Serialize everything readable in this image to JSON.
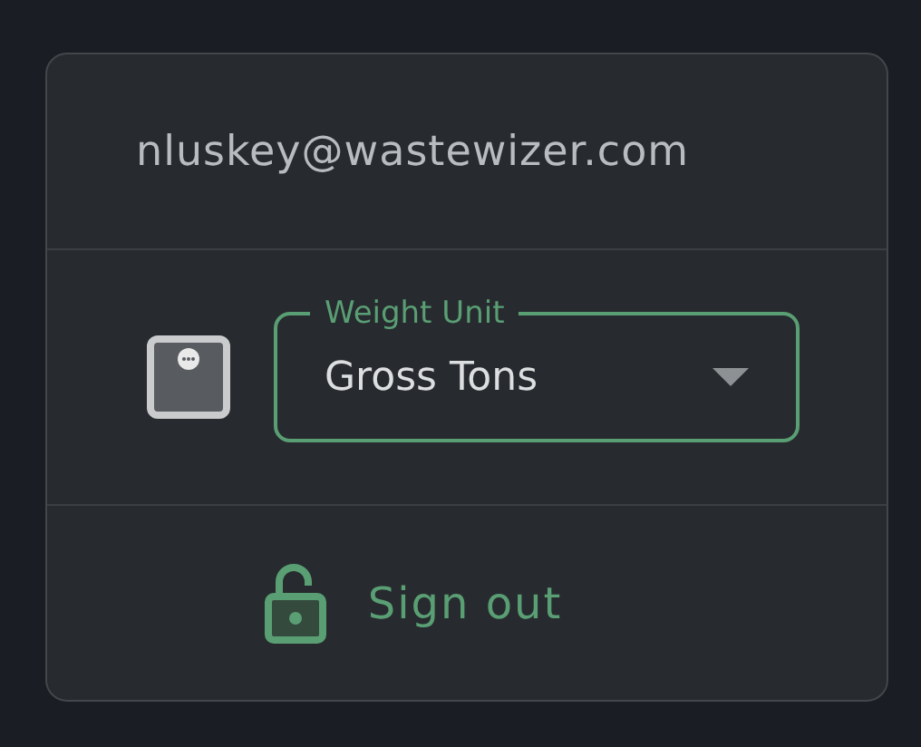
{
  "account": {
    "email": "nluskey@wastewizer.com"
  },
  "weight_unit": {
    "label": "Weight Unit",
    "value": "Gross Tons",
    "focused": true
  },
  "sign_out": {
    "label": "Sign out"
  }
}
